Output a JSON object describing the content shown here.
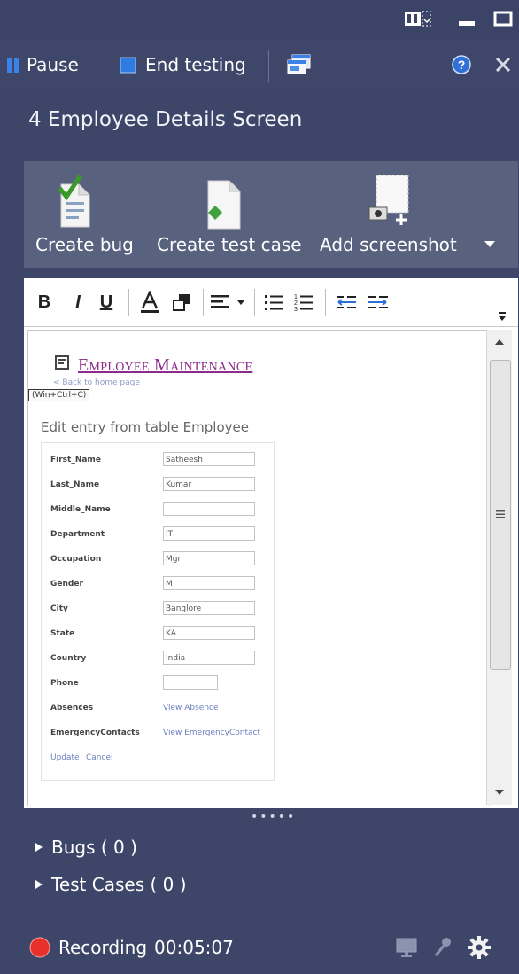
{
  "window": {
    "controls": {
      "layout": "layout-toggle-icon",
      "minimize": "minimize-icon",
      "restore": "restore-icon"
    }
  },
  "toolbar": {
    "pause_label": "Pause",
    "end_testing_label": "End testing"
  },
  "screen": {
    "title": "4 Employee Details Screen"
  },
  "actions": {
    "create_bug": "Create bug",
    "create_test_case": "Create test case",
    "add_screenshot": "Add screenshot"
  },
  "editor": {
    "toolbar": {
      "bold": "B",
      "italic": "I",
      "underline": "U"
    },
    "page": {
      "title": "Employee Maintenance",
      "back_link": "Back to home page",
      "tooltip": "(Win+Ctrl+C)",
      "edit_heading": "Edit entry from table Employee",
      "fields": [
        {
          "label": "First_Name",
          "value": "Satheesh"
        },
        {
          "label": "Last_Name",
          "value": "Kumar"
        },
        {
          "label": "Middle_Name",
          "value": ""
        },
        {
          "label": "Department",
          "value": "IT"
        },
        {
          "label": "Occupation",
          "value": "Mgr"
        },
        {
          "label": "Gender",
          "value": "M"
        },
        {
          "label": "City",
          "value": "Banglore"
        },
        {
          "label": "State",
          "value": "KA"
        },
        {
          "label": "Country",
          "value": "India"
        },
        {
          "label": "Phone",
          "value": ""
        }
      ],
      "links": [
        {
          "label": "Absences",
          "value": "View Absence"
        },
        {
          "label": "EmergencyContacts",
          "value": "View EmergencyContact"
        }
      ],
      "update": "Update",
      "cancel": "Cancel"
    }
  },
  "sections": {
    "bugs": "Bugs ( 0 )",
    "test_cases": "Test Cases ( 0 )"
  },
  "status": {
    "recording_label": "Recording",
    "time": "00:05:07"
  },
  "colors": {
    "background": "#3d4668",
    "actionbar": "#58627f",
    "link_purple": "#8b2b8a",
    "recording_red": "#e8312a",
    "help_blue": "#2f6fd6"
  }
}
